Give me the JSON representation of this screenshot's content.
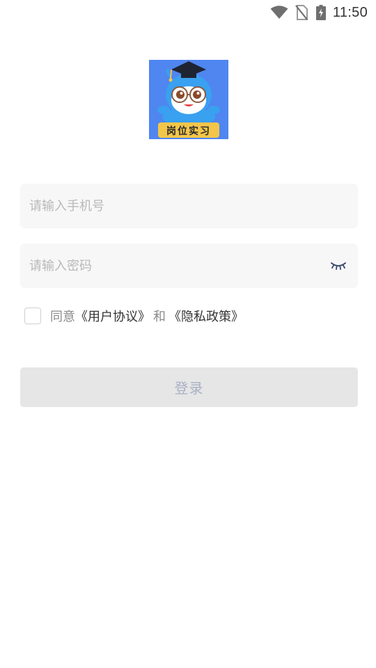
{
  "status_bar": {
    "time": "11:50",
    "icons": [
      "wifi-icon",
      "no-sim-icon",
      "battery-charging-icon"
    ]
  },
  "logo": {
    "text": "岗位实习",
    "icon": "owl-graduate-mascot",
    "colors": {
      "background": "#4f86f0",
      "banner": "#f3c64a",
      "mascot": "#3aa0f0"
    }
  },
  "form": {
    "phone_placeholder": "请输入手机号",
    "phone_value": "",
    "password_placeholder": "请输入密码",
    "password_value": "",
    "password_toggle_icon": "eye-closed-icon"
  },
  "agreement": {
    "checked": false,
    "prefix": "同意",
    "user_agreement": "《用户协议》",
    "and": "和",
    "privacy_policy": "《隐私政策》"
  },
  "login": {
    "label": "登录"
  }
}
